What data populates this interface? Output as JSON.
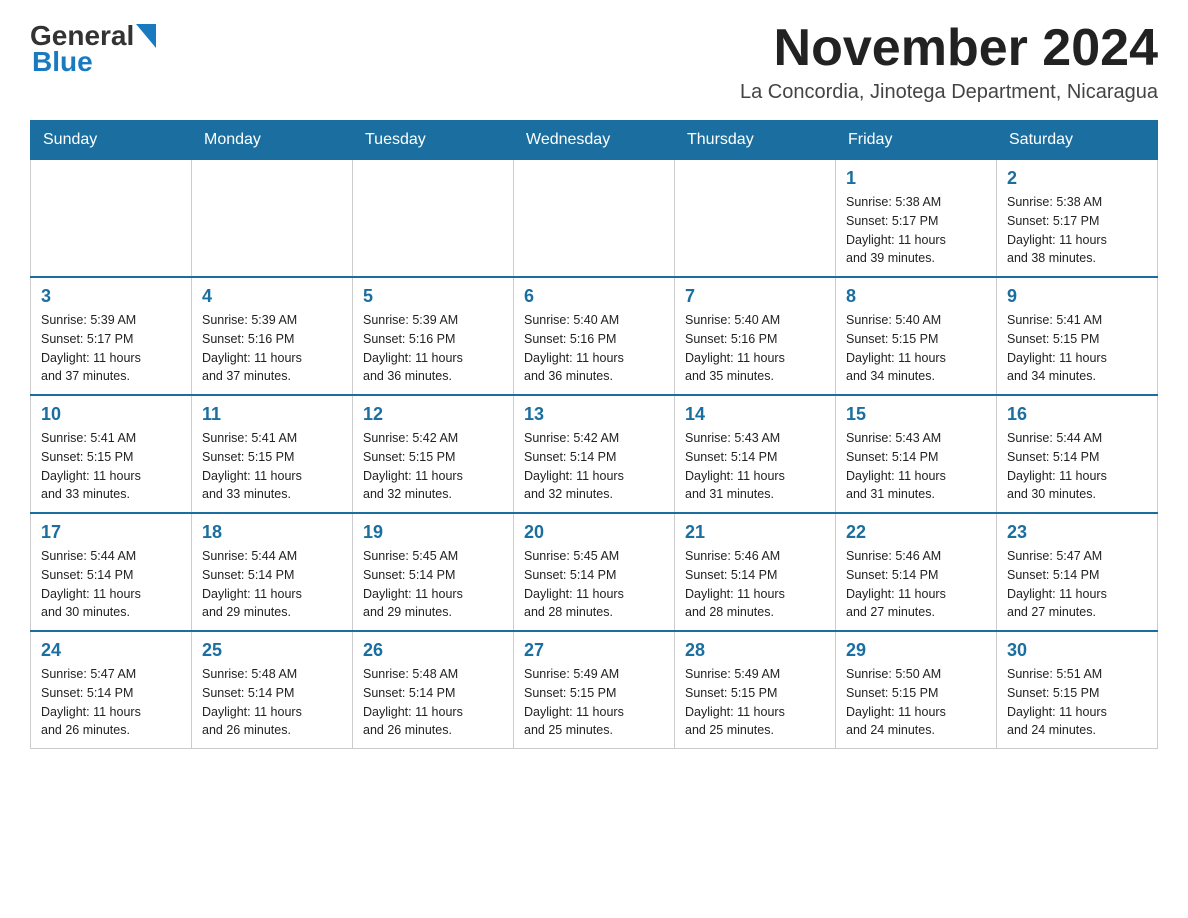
{
  "logo": {
    "text_general": "General",
    "text_blue": "Blue"
  },
  "header": {
    "month_title": "November 2024",
    "subtitle": "La Concordia, Jinotega Department, Nicaragua"
  },
  "days_of_week": [
    "Sunday",
    "Monday",
    "Tuesday",
    "Wednesday",
    "Thursday",
    "Friday",
    "Saturday"
  ],
  "weeks": [
    [
      {
        "day": "",
        "info": ""
      },
      {
        "day": "",
        "info": ""
      },
      {
        "day": "",
        "info": ""
      },
      {
        "day": "",
        "info": ""
      },
      {
        "day": "",
        "info": ""
      },
      {
        "day": "1",
        "info": "Sunrise: 5:38 AM\nSunset: 5:17 PM\nDaylight: 11 hours\nand 39 minutes."
      },
      {
        "day": "2",
        "info": "Sunrise: 5:38 AM\nSunset: 5:17 PM\nDaylight: 11 hours\nand 38 minutes."
      }
    ],
    [
      {
        "day": "3",
        "info": "Sunrise: 5:39 AM\nSunset: 5:17 PM\nDaylight: 11 hours\nand 37 minutes."
      },
      {
        "day": "4",
        "info": "Sunrise: 5:39 AM\nSunset: 5:16 PM\nDaylight: 11 hours\nand 37 minutes."
      },
      {
        "day": "5",
        "info": "Sunrise: 5:39 AM\nSunset: 5:16 PM\nDaylight: 11 hours\nand 36 minutes."
      },
      {
        "day": "6",
        "info": "Sunrise: 5:40 AM\nSunset: 5:16 PM\nDaylight: 11 hours\nand 36 minutes."
      },
      {
        "day": "7",
        "info": "Sunrise: 5:40 AM\nSunset: 5:16 PM\nDaylight: 11 hours\nand 35 minutes."
      },
      {
        "day": "8",
        "info": "Sunrise: 5:40 AM\nSunset: 5:15 PM\nDaylight: 11 hours\nand 34 minutes."
      },
      {
        "day": "9",
        "info": "Sunrise: 5:41 AM\nSunset: 5:15 PM\nDaylight: 11 hours\nand 34 minutes."
      }
    ],
    [
      {
        "day": "10",
        "info": "Sunrise: 5:41 AM\nSunset: 5:15 PM\nDaylight: 11 hours\nand 33 minutes."
      },
      {
        "day": "11",
        "info": "Sunrise: 5:41 AM\nSunset: 5:15 PM\nDaylight: 11 hours\nand 33 minutes."
      },
      {
        "day": "12",
        "info": "Sunrise: 5:42 AM\nSunset: 5:15 PM\nDaylight: 11 hours\nand 32 minutes."
      },
      {
        "day": "13",
        "info": "Sunrise: 5:42 AM\nSunset: 5:14 PM\nDaylight: 11 hours\nand 32 minutes."
      },
      {
        "day": "14",
        "info": "Sunrise: 5:43 AM\nSunset: 5:14 PM\nDaylight: 11 hours\nand 31 minutes."
      },
      {
        "day": "15",
        "info": "Sunrise: 5:43 AM\nSunset: 5:14 PM\nDaylight: 11 hours\nand 31 minutes."
      },
      {
        "day": "16",
        "info": "Sunrise: 5:44 AM\nSunset: 5:14 PM\nDaylight: 11 hours\nand 30 minutes."
      }
    ],
    [
      {
        "day": "17",
        "info": "Sunrise: 5:44 AM\nSunset: 5:14 PM\nDaylight: 11 hours\nand 30 minutes."
      },
      {
        "day": "18",
        "info": "Sunrise: 5:44 AM\nSunset: 5:14 PM\nDaylight: 11 hours\nand 29 minutes."
      },
      {
        "day": "19",
        "info": "Sunrise: 5:45 AM\nSunset: 5:14 PM\nDaylight: 11 hours\nand 29 minutes."
      },
      {
        "day": "20",
        "info": "Sunrise: 5:45 AM\nSunset: 5:14 PM\nDaylight: 11 hours\nand 28 minutes."
      },
      {
        "day": "21",
        "info": "Sunrise: 5:46 AM\nSunset: 5:14 PM\nDaylight: 11 hours\nand 28 minutes."
      },
      {
        "day": "22",
        "info": "Sunrise: 5:46 AM\nSunset: 5:14 PM\nDaylight: 11 hours\nand 27 minutes."
      },
      {
        "day": "23",
        "info": "Sunrise: 5:47 AM\nSunset: 5:14 PM\nDaylight: 11 hours\nand 27 minutes."
      }
    ],
    [
      {
        "day": "24",
        "info": "Sunrise: 5:47 AM\nSunset: 5:14 PM\nDaylight: 11 hours\nand 26 minutes."
      },
      {
        "day": "25",
        "info": "Sunrise: 5:48 AM\nSunset: 5:14 PM\nDaylight: 11 hours\nand 26 minutes."
      },
      {
        "day": "26",
        "info": "Sunrise: 5:48 AM\nSunset: 5:14 PM\nDaylight: 11 hours\nand 26 minutes."
      },
      {
        "day": "27",
        "info": "Sunrise: 5:49 AM\nSunset: 5:15 PM\nDaylight: 11 hours\nand 25 minutes."
      },
      {
        "day": "28",
        "info": "Sunrise: 5:49 AM\nSunset: 5:15 PM\nDaylight: 11 hours\nand 25 minutes."
      },
      {
        "day": "29",
        "info": "Sunrise: 5:50 AM\nSunset: 5:15 PM\nDaylight: 11 hours\nand 24 minutes."
      },
      {
        "day": "30",
        "info": "Sunrise: 5:51 AM\nSunset: 5:15 PM\nDaylight: 11 hours\nand 24 minutes."
      }
    ]
  ]
}
